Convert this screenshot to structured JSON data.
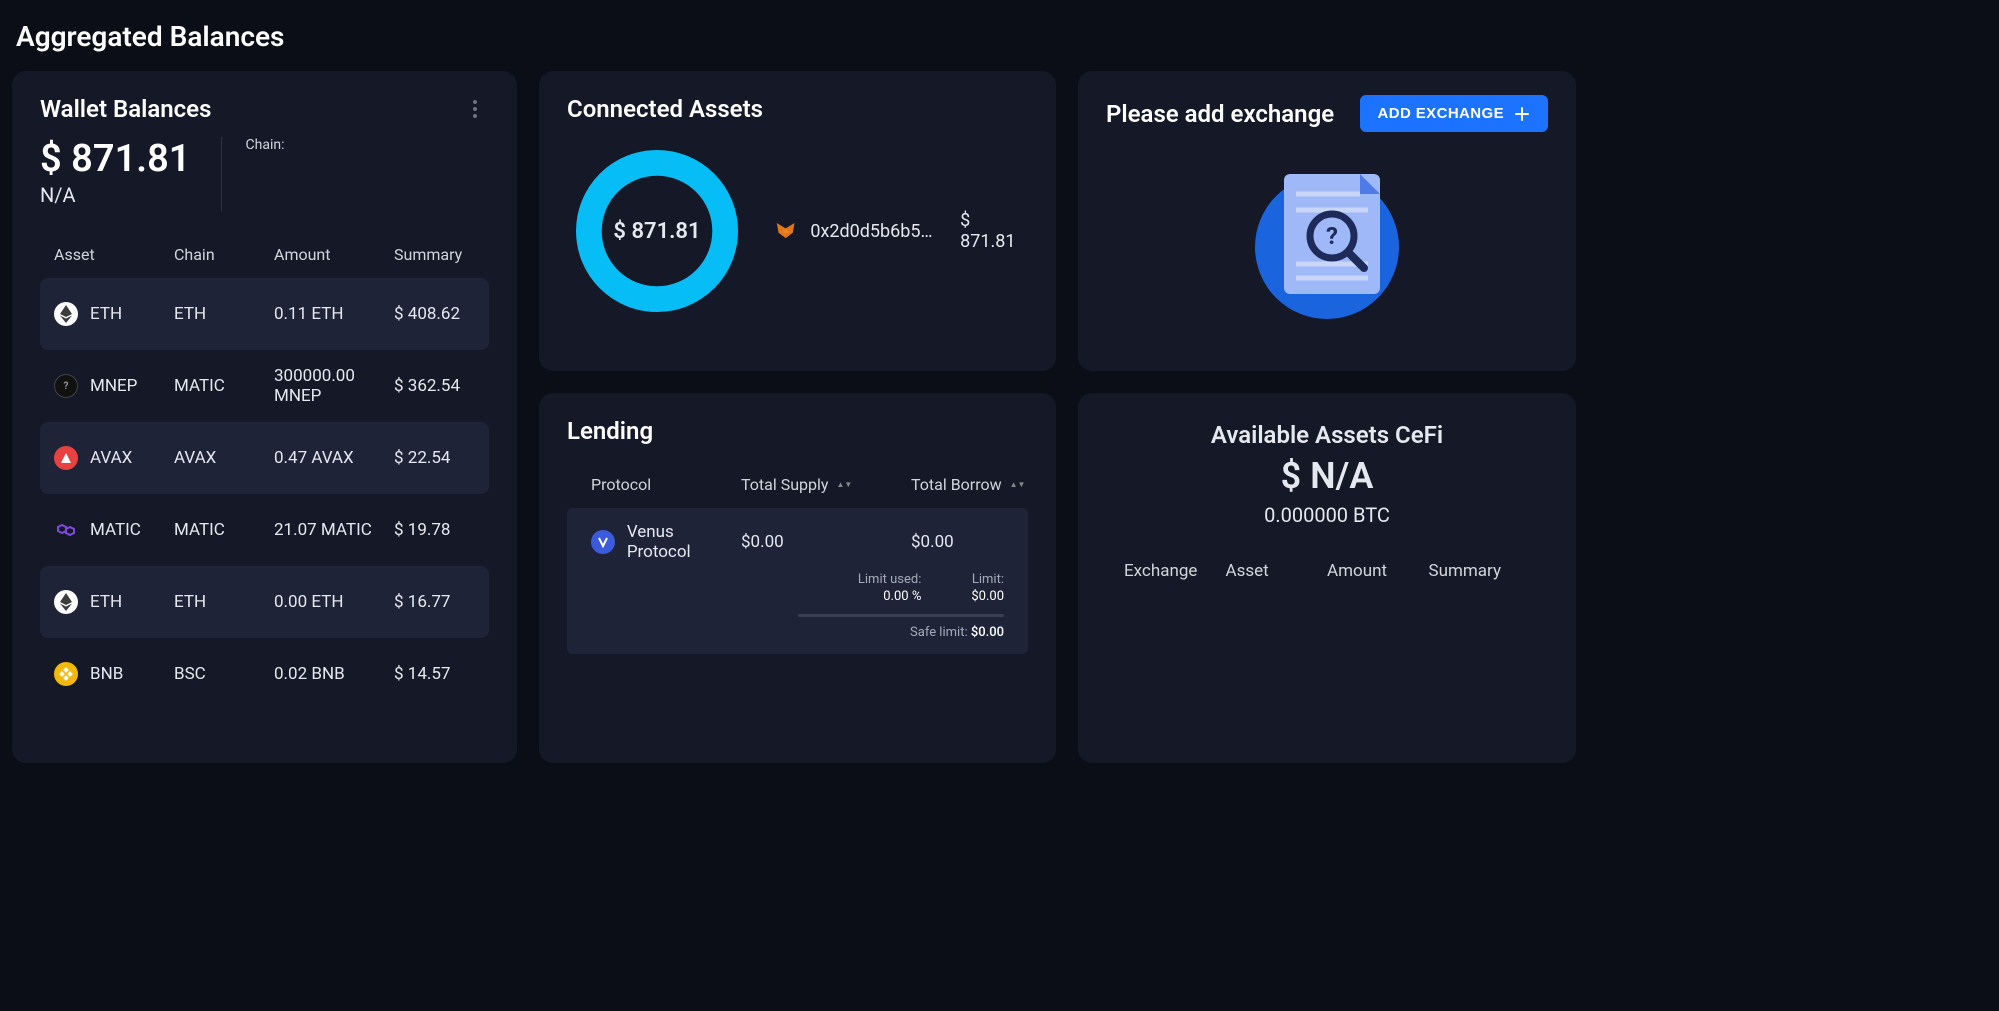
{
  "page_title": "Aggregated Balances",
  "wallet": {
    "title": "Wallet Balances",
    "total": "$ 871.81",
    "subtotal": "N/A",
    "chain_label": "Chain:",
    "columns": {
      "asset": "Asset",
      "chain": "Chain",
      "amount": "Amount",
      "summary": "Summary"
    },
    "rows": [
      {
        "icon": "eth",
        "asset": "ETH",
        "chain": "ETH",
        "amount": "0.11 ETH",
        "summary": "$ 408.62"
      },
      {
        "icon": "mnep",
        "asset": "MNEP",
        "chain": "MATIC",
        "amount": "300000.00 MNEP",
        "summary": "$ 362.54"
      },
      {
        "icon": "avax",
        "asset": "AVAX",
        "chain": "AVAX",
        "amount": "0.47 AVAX",
        "summary": "$ 22.54"
      },
      {
        "icon": "matic",
        "asset": "MATIC",
        "chain": "MATIC",
        "amount": "21.07 MATIC",
        "summary": "$ 19.78"
      },
      {
        "icon": "eth",
        "asset": "ETH",
        "chain": "ETH",
        "amount": "0.00 ETH",
        "summary": "$ 16.77"
      },
      {
        "icon": "bnb",
        "asset": "BNB",
        "chain": "BSC",
        "amount": "0.02 BNB",
        "summary": "$ 14.57"
      }
    ]
  },
  "connected": {
    "title": "Connected Assets",
    "center_amount": "$ 871.81",
    "entries": [
      {
        "address": "0x2d0d5b6b5…",
        "amount": "$ 871.81"
      }
    ]
  },
  "exchange": {
    "title": "Please add exchange",
    "button": "ADD EXCHANGE"
  },
  "lending": {
    "title": "Lending",
    "columns": {
      "protocol": "Protocol",
      "supply": "Total Supply",
      "borrow": "Total Borrow"
    },
    "row": {
      "protocol": "Venus Protocol",
      "supply": "$0.00",
      "borrow": "$0.00",
      "limit_used_label": "Limit used:",
      "limit_used_value": "0.00 %",
      "limit_label": "Limit:",
      "limit_value": "$0.00",
      "safe_label": "Safe limit: ",
      "safe_value": "$0.00"
    }
  },
  "cefi": {
    "title": "Available Assets CeFi",
    "amount": "$ N/A",
    "btc": "0.000000 BTC",
    "columns": {
      "exchange": "Exchange",
      "asset": "Asset",
      "amount": "Amount",
      "summary": "Summary"
    }
  },
  "chart_data": {
    "type": "pie",
    "title": "Connected Assets",
    "series": [
      {
        "name": "0x2d0d5b6b5…",
        "value": 871.81,
        "color": "#06bdf6"
      }
    ],
    "center_label": "$ 871.81"
  }
}
